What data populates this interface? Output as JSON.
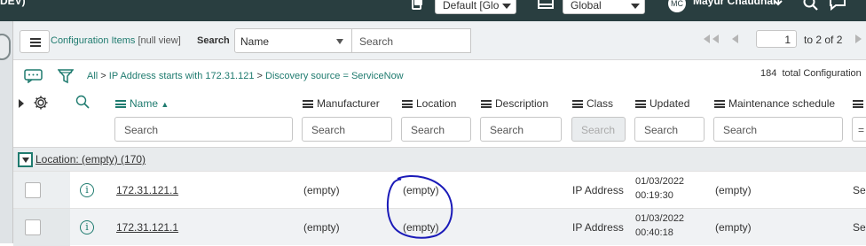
{
  "topbar": {
    "instance_suffix": "DEV)",
    "update_set": "Default [Glo",
    "application_scope": "Global",
    "user_initials": "MC",
    "user_name": "Mayur Chaudhari"
  },
  "toolbar": {
    "title": "Configuration Items",
    "view": "[null view]",
    "search_label": "Search",
    "search_field": "Name",
    "search_placeholder": "Search",
    "page_current": "1",
    "page_range": "to 2 of 2"
  },
  "breadcrumb": {
    "all": "All",
    "sep1": ">",
    "filter1": "IP Address starts with 172.31.121",
    "sep2": ">",
    "filter2": "Discovery source = ServiceNow",
    "total_count": "184",
    "total_label": "total Configuration"
  },
  "columns": {
    "name": "Name",
    "manufacturer": "Manufacturer",
    "location": "Location",
    "description": "Description",
    "class": "Class",
    "updated": "Updated",
    "maintenance_schedule": "Maintenance schedule"
  },
  "filters": {
    "name": "Search",
    "manufacturer": "Search",
    "location": "Search",
    "description": "Search",
    "class": "Search",
    "updated": "Search",
    "maintenance_schedule": "Search",
    "last": "="
  },
  "group": {
    "label": "Location: (empty) (170)"
  },
  "rows": [
    {
      "name": "172.31.121.1",
      "manufacturer": "(empty)",
      "location": "(empty)",
      "class": "IP Address",
      "updated_date": "01/03/2022",
      "updated_time": "00:19:30",
      "maintenance_schedule": "(empty)",
      "truncated": "Ser"
    },
    {
      "name": "172.31.121.1",
      "manufacturer": "(empty)",
      "location": "(empty)",
      "class": "IP Address",
      "updated_date": "01/03/2022",
      "updated_time": "00:40:18",
      "maintenance_schedule": "(empty)",
      "truncated": "Ser"
    }
  ],
  "colors": {
    "header_bg": "#293e40",
    "accent": "#1f7b6f",
    "annotation": "#1a1ab8"
  }
}
